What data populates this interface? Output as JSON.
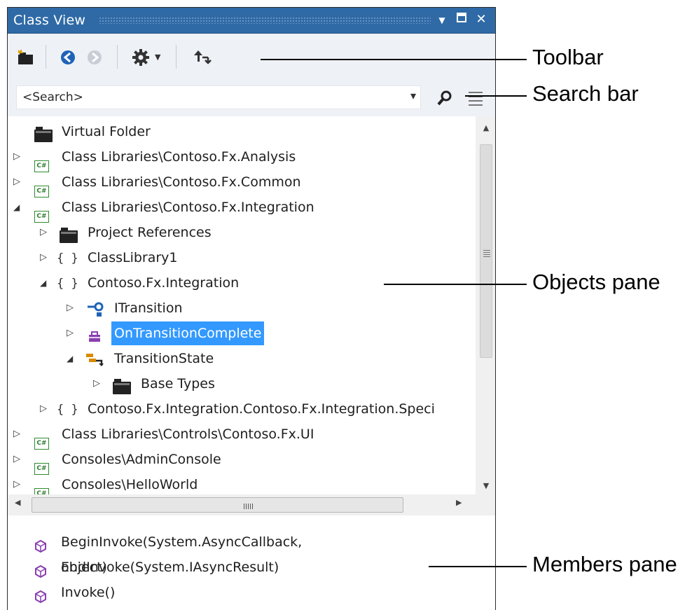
{
  "window": {
    "title": "Class View"
  },
  "search": {
    "placeholder": "<Search>"
  },
  "tree": [
    {
      "label": "Virtual Folder"
    },
    {
      "label": "Class Libraries\\Contoso.Fx.Analysis"
    },
    {
      "label": "Class Libraries\\Contoso.Fx.Common"
    },
    {
      "label": "Class Libraries\\Contoso.Fx.Integration"
    },
    {
      "label": "Project References"
    },
    {
      "label": "ClassLibrary1"
    },
    {
      "label": "Contoso.Fx.Integration"
    },
    {
      "label": "ITransition"
    },
    {
      "label": "OnTransitionComplete"
    },
    {
      "label": "TransitionState"
    },
    {
      "label": "Base Types"
    },
    {
      "label": "Contoso.Fx.Integration.Contoso.Fx.Integration.Speci"
    },
    {
      "label": "Class Libraries\\Controls\\Contoso.Fx.UI"
    },
    {
      "label": "Consoles\\AdminConsole"
    },
    {
      "label": "Consoles\\HelloWorld"
    }
  ],
  "members": [
    {
      "label": "BeginInvoke(System.AsyncCallback, object)"
    },
    {
      "label": "EndInvoke(System.IAsyncResult)"
    },
    {
      "label": "Invoke()"
    }
  ],
  "callouts": {
    "toolbar": "Toolbar",
    "search_bar": "Search bar",
    "objects_pane": "Objects pane",
    "members_pane": "Members pane"
  },
  "icons": {
    "project": "cs-project-icon",
    "folder": "folder-icon",
    "namespace": "namespace-icon",
    "interface": "interface-icon",
    "delegate": "delegate-icon",
    "enum": "enum-icon",
    "method": "method-icon"
  },
  "colors": {
    "titlebar": "#2f6aa6",
    "selection": "#3399ff",
    "method_icon": "#8a3fb0"
  }
}
